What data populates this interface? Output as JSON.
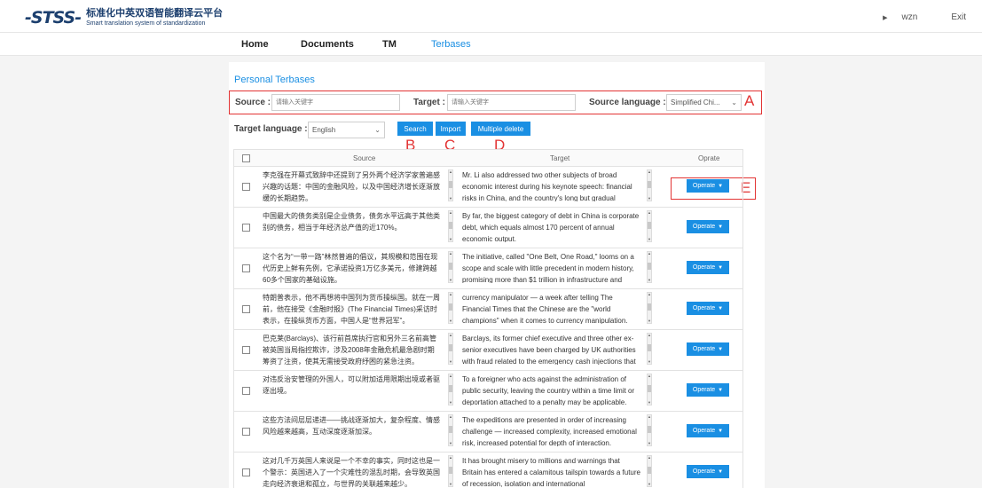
{
  "header": {
    "logo_mark": "STSS",
    "logo_cn": "标准化中英双语智能翻译云平台",
    "logo_en": "Smart translation system of standardization",
    "username": "wzn",
    "exit_label": "Exit"
  },
  "nav": {
    "items": [
      {
        "label": "Home"
      },
      {
        "label": "Documents"
      },
      {
        "label": "TM"
      },
      {
        "label": "Terbases"
      }
    ],
    "active": "Terbases"
  },
  "page": {
    "title": "Personal Terbases"
  },
  "filters": {
    "source_label": "Source :",
    "source_placeholder": "请输入关键字",
    "target_label": "Target :",
    "target_placeholder": "请输入关键字",
    "source_language_label": "Source language :",
    "source_language_value": "Simplified Chi...",
    "target_language_label": "Target language :",
    "target_language_value": "English"
  },
  "buttons": {
    "search": "Search",
    "import": "Import",
    "multiple_delete": "Multiple delete"
  },
  "annotations": {
    "a": "A",
    "b": "B",
    "c": "C",
    "d": "D",
    "e": "E"
  },
  "table": {
    "columns": {
      "source": "Source",
      "target": "Target",
      "operate": "Oprate"
    },
    "operate_label": "Operate",
    "rows": [
      {
        "source": "李克强在开幕式致辞中还提到了另外两个经济学家普遍感兴趣的话题：中国的金融风险，以及中国经济增长逐渐放缓的长期趋势。",
        "target": "Mr. Li also addressed two other subjects of broad economic interest during his keynote speech: financial risks in China, and the country's long but gradual slowdown."
      },
      {
        "source": "中国最大的债务类别是企业债务，债务水平远高于其他类别的债务，相当于年经济总产值的近170%。",
        "target": "By far, the biggest category of debt in China is corporate debt, which equals almost 170 percent of annual economic output."
      },
      {
        "source": "这个名为“一带一路”林然普遍的倡议，其规模和范围在现代历史上鲜有先例，它承诺投资1万亿多美元，修建跨越60多个国家的基础设施。",
        "target": "The initiative, called \"One Belt, One Road,\" looms on a scope and scale with little precedent in modern history, promising more than $1 trillion in infrastructure and"
      },
      {
        "source": "特朗普表示，他不再想将中国列为货币操纵国。就在一周前，他在接受《金融时报》(The Financial Times)采访时表示，在操纵货币方面，中国人是“世界冠军”。",
        "target": "currency manipulator — a week after telling The Financial Times that the Chinese are the \"world champions\" when it comes to currency manipulation."
      },
      {
        "source": "巴克莱(Barclays)、该行前首席执行官和另外三名前高管被英国当局指控欺诈，涉及2008年金融危机最急剧时期筹资了注资，使其无需接受政府纾困的紧急注资。",
        "target": "Barclays, its former chief executive and three other ex-senior executives have been charged by UK authorities with fraud related to the emergency cash injections that"
      },
      {
        "source": "对违反治安管理的外国人，可以附加适用限期出境或者驱逐出境。",
        "target": "To a foreigner who acts against the administration of public security, leaving the country within a time limit or deportation attached to a penalty may be applicable."
      },
      {
        "source": "这些方法间层层递进——挑战逐渐加大，复杂程度、情感风险越来越高，互动深度逐渐加深。",
        "target": "The expeditions are presented in order of increasing challenge — increased complexity, increased emotional risk, increased potential for depth of interaction."
      },
      {
        "source": "这对几千万英国人来说是一个不幸的事实，同时这也是一个警示：英国进入了一个灾难性的混乱时期，会导致英国走向经济衰退和孤立，与世界的关联越来越少。",
        "target": "It has brought misery to millions and warnings that Britain has entered a calamitous tailspin towards a future of recession, isolation and international"
      }
    ]
  }
}
